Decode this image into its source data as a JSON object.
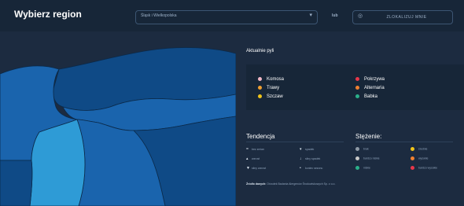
{
  "header": {
    "title": "Wybierz region",
    "region_value": "Śląsk i Wielkopolska",
    "or_label": "lub",
    "locate_label": "ZLOKALIZUJ MNIE"
  },
  "pollen": {
    "section_title": "Aktualnie pyli",
    "left": [
      {
        "name": "Komosa",
        "color": "#f2b8c6"
      },
      {
        "name": "Trawy",
        "color": "#f0a030"
      },
      {
        "name": "Szczaw",
        "color": "#f0c419"
      }
    ],
    "right": [
      {
        "name": "Pokrzywa",
        "color": "#e8374a"
      },
      {
        "name": "Alternaria",
        "color": "#f08030"
      },
      {
        "name": "Babka",
        "color": "#2bb08a"
      }
    ]
  },
  "trend": {
    "title": "Tendencja",
    "items": [
      {
        "glyph": "=",
        "label": "bez zmian"
      },
      {
        "glyph": "▾",
        "label": "spadek"
      },
      {
        "glyph": "▴",
        "label": "wzrost"
      },
      {
        "glyph": "↓",
        "label": "silny spadek"
      },
      {
        "glyph": "▼",
        "label": "silny wzrost"
      },
      {
        "glyph": "•",
        "label": "koniec sezonu"
      }
    ]
  },
  "concentration": {
    "title": "Stężenie:",
    "items": [
      {
        "label": "brak",
        "color": "#8f9aa6"
      },
      {
        "label": "średnie",
        "color": "#f0c419"
      },
      {
        "label": "bardzo niskie",
        "color": "#c8c8c8"
      },
      {
        "label": "wysokie",
        "color": "#f08030"
      },
      {
        "label": "niskie",
        "color": "#2bb08a"
      },
      {
        "label": "bardzo wysokie",
        "color": "#e8374a"
      }
    ]
  },
  "source": {
    "label": "Źródło danych:",
    "text": "Ośrodek Badania Alergenów Środowiskowych Sp. z o.o."
  },
  "map_colors": {
    "dark": "#0f4a86",
    "mid": "#1a64ad",
    "light": "#2e9bd6",
    "border": "#0b2a4a"
  }
}
